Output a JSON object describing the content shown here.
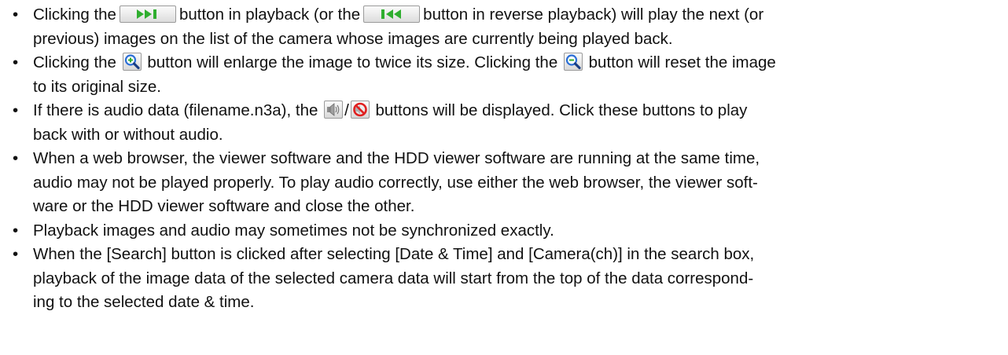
{
  "bullet_glyph": "•",
  "icons": {
    "next": "skip-forward-icon",
    "prev": "skip-back-icon",
    "zoom_in": "zoom-in-icon",
    "zoom_reset": "zoom-reset-icon",
    "audio_on": "speaker-icon",
    "audio_off": "mute-icon",
    "green": "#2fae2f",
    "magnifier_blue": "#2c6fd6",
    "no_sign_red": "#e02020"
  },
  "bullets": [
    {
      "lines": [
        [
          "Clicking the",
          "button in playback (or the",
          "button in reverse playback) will play the next (or"
        ],
        [
          "previous) images on the list of the camera whose images are currently being played back."
        ]
      ]
    },
    {
      "lines": [
        [
          "Clicking the",
          "button will enlarge the image to twice its size. Clicking the",
          "button will reset the image"
        ],
        [
          "to its original size."
        ]
      ]
    },
    {
      "lines": [
        [
          "If there is audio data (filename.n3a), the",
          "/",
          "buttons will be displayed. Click these buttons to play"
        ],
        [
          "back with or without audio."
        ]
      ]
    },
    {
      "lines": [
        [
          "When a web browser, the viewer software and the HDD viewer software are running at the same time,"
        ],
        [
          "audio may not be played properly. To play audio correctly, use either the web browser, the viewer soft-"
        ],
        [
          "ware or the HDD viewer software and close the other."
        ]
      ]
    },
    {
      "lines": [
        [
          "Playback images and audio may sometimes not be synchronized exactly."
        ]
      ]
    },
    {
      "lines": [
        [
          "When the [Search] button is clicked after selecting [Date & Time] and [Camera(ch)] in the search box,"
        ],
        [
          "playback of the image data of the selected camera data will start from the top of the data correspond-"
        ],
        [
          "ing to the selected date & time."
        ]
      ]
    }
  ]
}
